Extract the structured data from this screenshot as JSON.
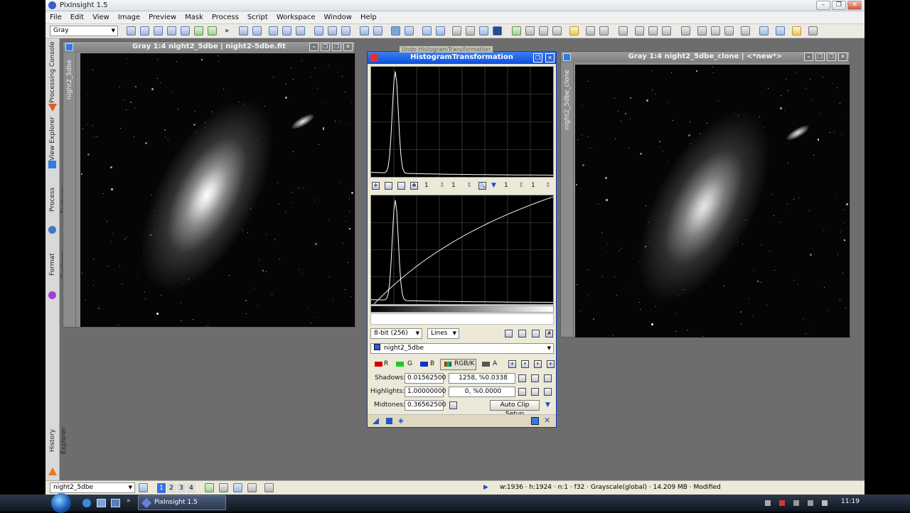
{
  "app": {
    "title": "PixInsight 1.5"
  },
  "window_controls": {
    "minimize": "–",
    "restore": "❐",
    "close": "✕"
  },
  "menu": [
    "File",
    "Edit",
    "View",
    "Image",
    "Preview",
    "Mask",
    "Process",
    "Script",
    "Workspace",
    "Window",
    "Help"
  ],
  "toolbar": {
    "color_mode": "Gray",
    "more": "»"
  },
  "left_panel": {
    "tabs": [
      "Processing Console",
      "View Explorer",
      "Process Explorer",
      "Format Explorer",
      "History Explorer"
    ]
  },
  "image_window_1": {
    "title": "Gray 1:4 night2_5dbe | night2-5dbe.fit",
    "side_label": "night2_5dbe"
  },
  "image_window_2": {
    "title": "Gray 1:4 night2_5dbe_clone | <*new*>",
    "side_label": "night2_5dbe_clone"
  },
  "histogram": {
    "title": "HistogramTransformation",
    "tooltip": "Undo HistogramTransformation",
    "zoom": {
      "h": "1",
      "v": "1",
      "h2": "1",
      "v2": "1"
    },
    "resolution": "8-bit (256)",
    "plot_mode": "Lines",
    "view": "night2_5dbe",
    "channels": [
      "R",
      "G",
      "B",
      "RGB/K",
      "A"
    ],
    "shadows_label": "Shadows:",
    "shadows_value": "0.01562500",
    "shadows_clip": "1258, %0.0338",
    "highlights_label": "Highlights:",
    "highlights_value": "1.00000000",
    "highlights_clip": "0, %0.0000",
    "midtones_label": "Midtones:",
    "midtones_value": "0.36562500",
    "auto_clip": "Auto Clip Setup"
  },
  "statusbar": {
    "view": "night2_5dbe",
    "pages": [
      "1",
      "2",
      "3",
      "4"
    ],
    "info": "w:1936 · h:1924 · n:1 · f32 · Grayscale(global) · 14.209 MB · Modified"
  },
  "taskbar": {
    "task": "PixInsight 1.5",
    "clock": "11:19"
  }
}
